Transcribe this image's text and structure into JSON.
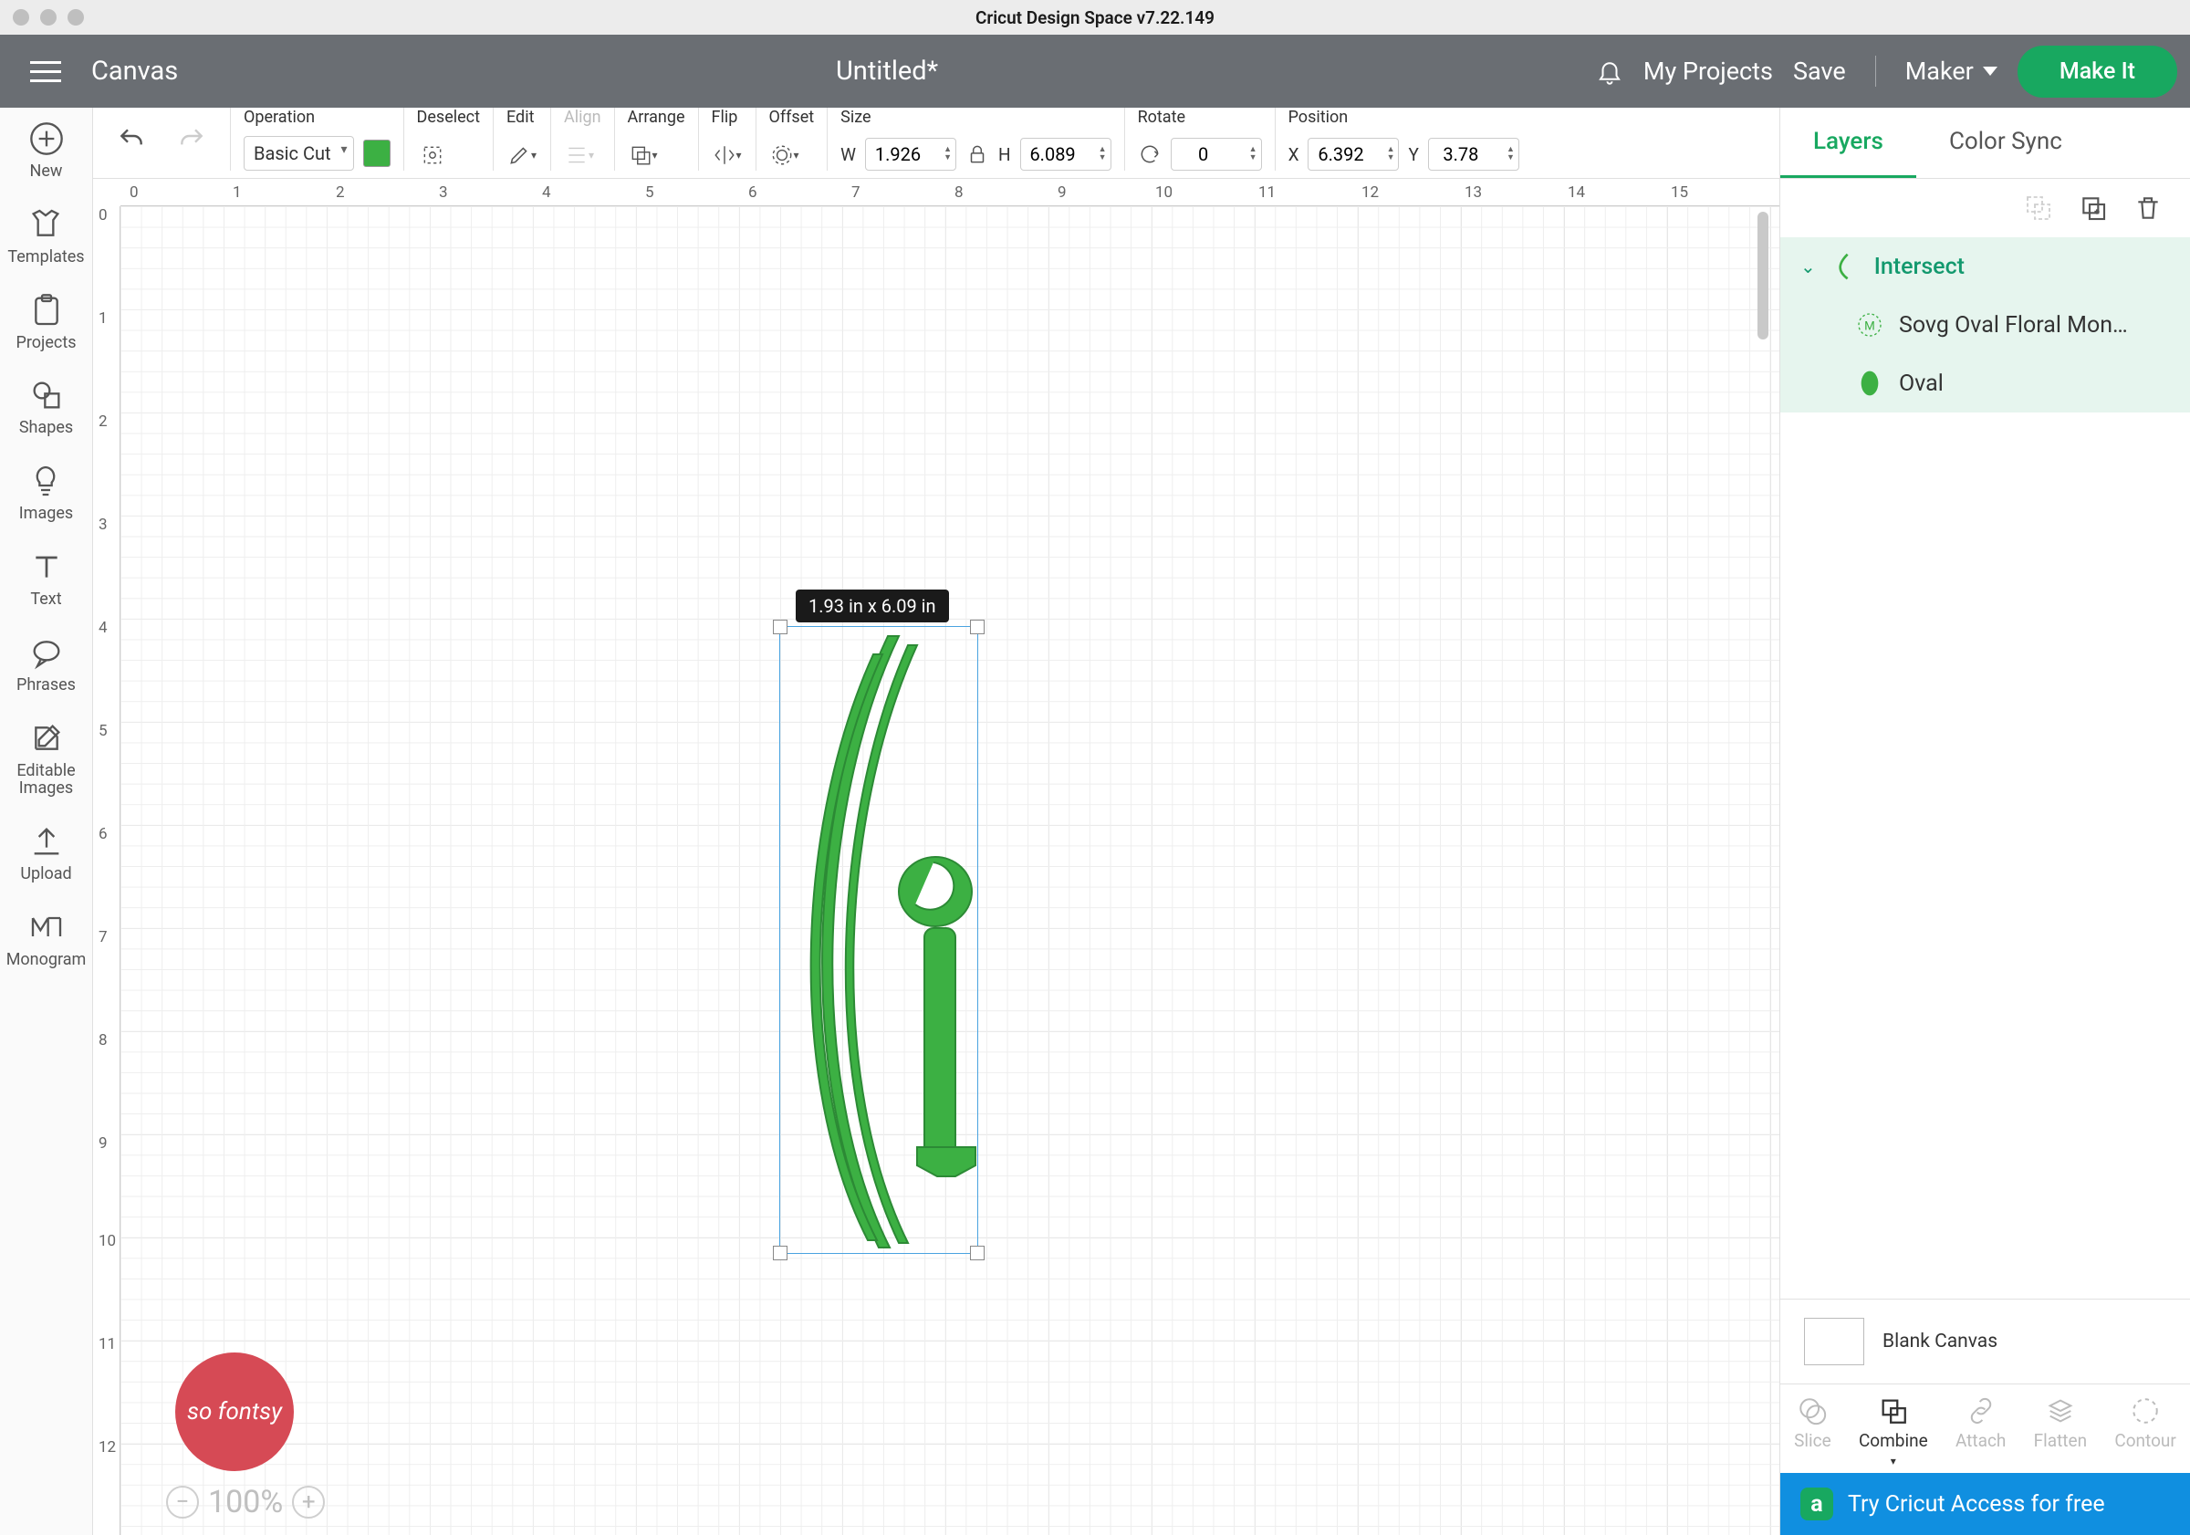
{
  "app_title": "Cricut Design Space  v7.22.149",
  "header": {
    "canvas": "Canvas",
    "document": "Untitled*",
    "my_projects": "My Projects",
    "save": "Save",
    "machine": "Maker",
    "make_it": "Make It"
  },
  "leftbar": [
    {
      "label": "New",
      "icon": "plus-circle"
    },
    {
      "label": "Templates",
      "icon": "shirt"
    },
    {
      "label": "Projects",
      "icon": "clipboard"
    },
    {
      "label": "Shapes",
      "icon": "shapes"
    },
    {
      "label": "Images",
      "icon": "bulb"
    },
    {
      "label": "Text",
      "icon": "text"
    },
    {
      "label": "Phrases",
      "icon": "phrase"
    },
    {
      "label": "Editable Images",
      "icon": "edit-img"
    },
    {
      "label": "Upload",
      "icon": "upload"
    },
    {
      "label": "Monogram",
      "icon": "monogram"
    }
  ],
  "toolbar": {
    "operation_label": "Operation",
    "operation_value": "Basic Cut",
    "deselect": "Deselect",
    "edit": "Edit",
    "align": "Align",
    "arrange": "Arrange",
    "flip": "Flip",
    "offset": "Offset",
    "size": "Size",
    "size_w_label": "W",
    "size_w": "1.926",
    "size_h_label": "H",
    "size_h": "6.089",
    "rotate": "Rotate",
    "rotate_val": "0",
    "position": "Position",
    "x_label": "X",
    "x": "6.392",
    "y_label": "Y",
    "y": "3.78"
  },
  "canvas": {
    "selection_tip": "1.93  in x 6.09  in",
    "zoom": "100%",
    "watermark": "so fontsy"
  },
  "rpanel": {
    "tab_layers": "Layers",
    "tab_colorsync": "Color Sync",
    "layers": [
      {
        "name": "Intersect",
        "level": 0
      },
      {
        "name": "Sovg Oval Floral Mon…",
        "level": 1
      },
      {
        "name": "Oval",
        "level": 1
      }
    ],
    "blank_canvas": "Blank Canvas",
    "ops": [
      "Slice",
      "Combine",
      "Attach",
      "Flatten",
      "Contour"
    ],
    "promo": "Try Cricut Access for free",
    "promo_badge": "a"
  },
  "colors": {
    "accent": "#18a860",
    "shape": "#3cb043"
  }
}
